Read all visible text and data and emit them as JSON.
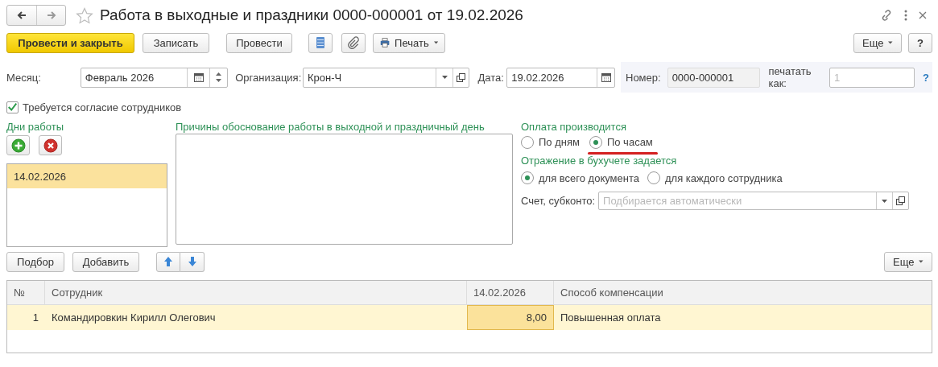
{
  "window": {
    "title": "Работа в выходные и праздники 0000-000001 от 19.02.2026",
    "favorite": false
  },
  "toolbar": {
    "primary": "Провести и закрыть",
    "buttons": [
      "Записать",
      "Провести"
    ],
    "print": "Печать",
    "more": "Еще",
    "help": "?"
  },
  "header_fields": {
    "month": {
      "label": "Месяц:",
      "value": "Февраль 2026"
    },
    "organization": {
      "label": "Организация:",
      "value": "Крон-Ч"
    },
    "date": {
      "label": "Дата:",
      "value": "19.02.2026"
    },
    "number": {
      "label": "Номер:",
      "value": "0000-000001"
    },
    "print_as": {
      "label": "печатать как:",
      "placeholder": "1"
    },
    "help": "?"
  },
  "consent_checkbox": {
    "label": "Требуется согласие сотрудников",
    "checked": true
  },
  "work_days": {
    "title": "Дни работы",
    "items": [
      {
        "date": "14.02.2026",
        "selected": true
      }
    ]
  },
  "reasons": {
    "title": "Причины обоснование работы в выходной и праздничный день"
  },
  "payment": {
    "title": "Оплата производится",
    "options": [
      {
        "label": "По дням",
        "selected": false,
        "annotated": false
      },
      {
        "label": "По часам",
        "selected": true,
        "annotated": true
      }
    ]
  },
  "accounting": {
    "title": "Отражение в бухучете задается",
    "options": [
      {
        "label": "для всего документа",
        "selected": true
      },
      {
        "label": "для каждого сотрудника",
        "selected": false
      }
    ],
    "account_field": {
      "label": "Счет, субконто:",
      "placeholder": "Подбирается автоматически"
    }
  },
  "table_toolbar": {
    "buttons": [
      "Подбор",
      "Добавить"
    ],
    "more": "Еще"
  },
  "table": {
    "columns": [
      "№",
      "Сотрудник",
      "14.02.2026",
      "Способ компенсации"
    ],
    "rows": [
      {
        "selected": true,
        "cells": [
          {
            "text": "1",
            "active": false
          },
          {
            "text": "Командировкин Кирилл Олегович",
            "active": false
          },
          {
            "text": "8,00",
            "active": true
          },
          {
            "text": "Повышенная оплата",
            "active": false
          }
        ]
      }
    ]
  }
}
